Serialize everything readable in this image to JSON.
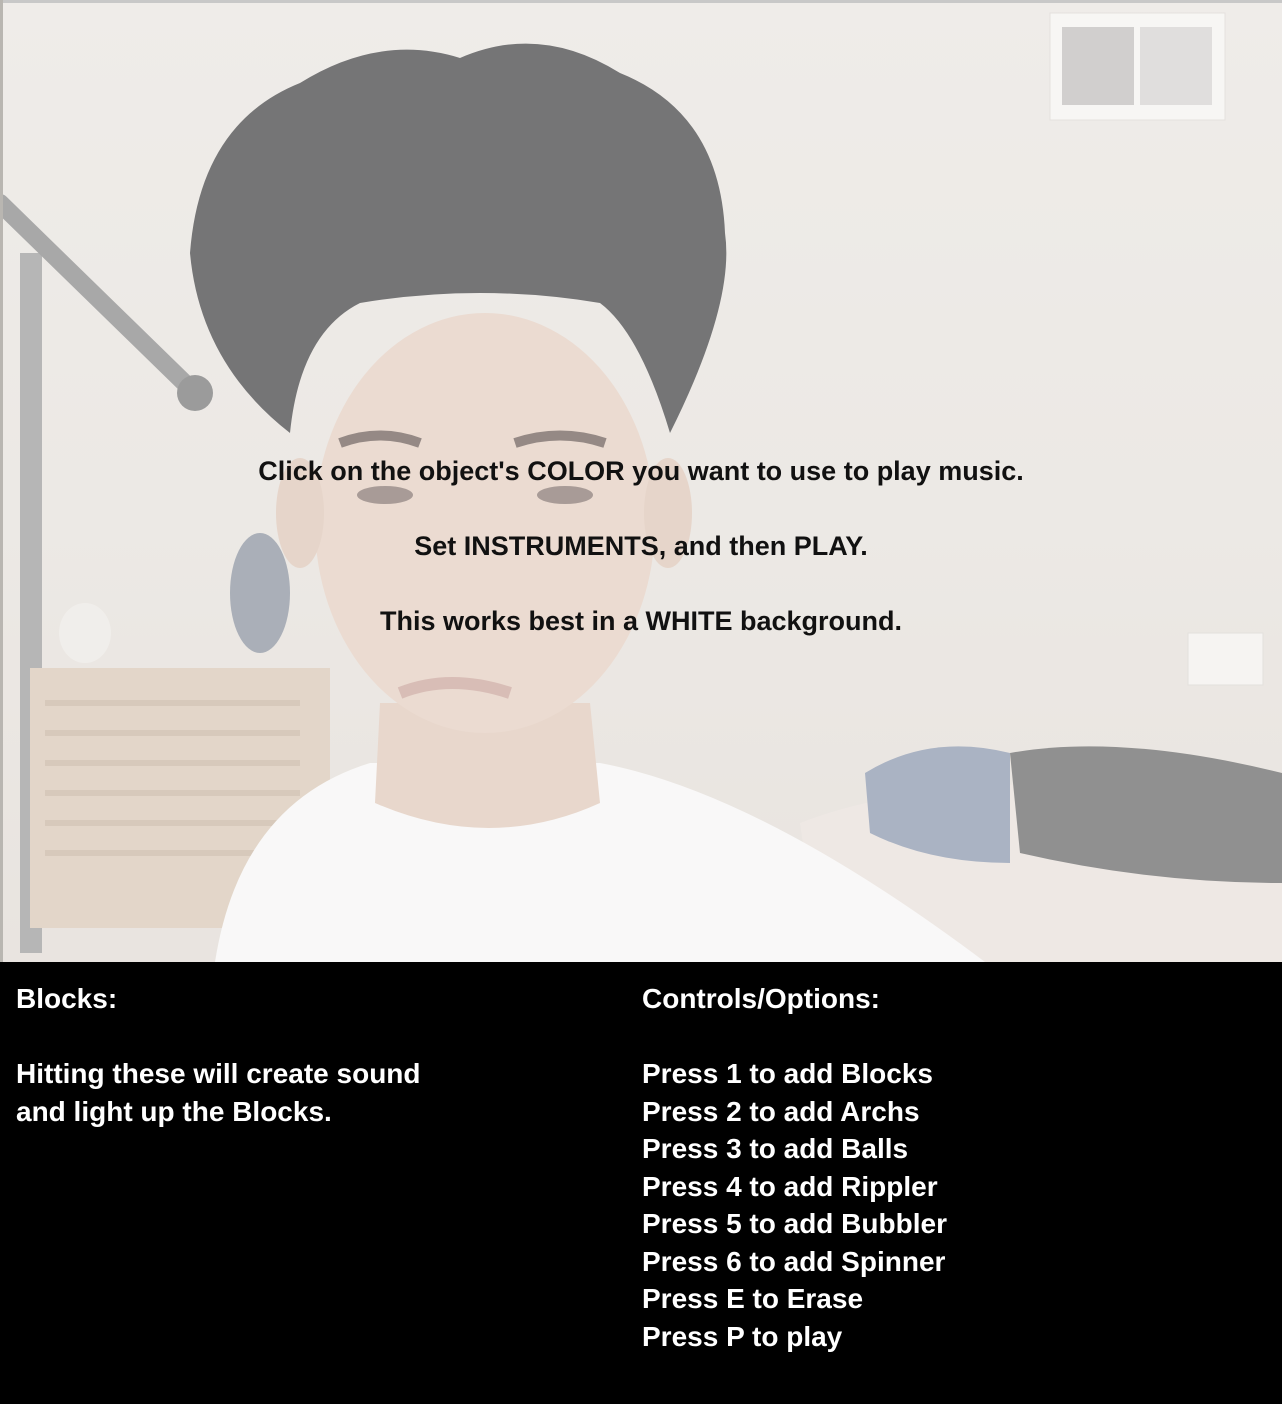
{
  "instructions": {
    "line1": "Click on the object's COLOR you want to use to play music.",
    "line2": "Set INSTRUMENTS, and then PLAY.",
    "line3": "This works best in a WHITE background."
  },
  "blocks_panel": {
    "heading": "Blocks:",
    "description_lines": [
      "Hitting these will create sound",
      "and light up the Blocks."
    ]
  },
  "controls_panel": {
    "heading": "Controls/Options:",
    "items": [
      "Press 1 to add Blocks",
      "Press 2 to add Archs",
      "Press 3 to add Balls",
      "Press 4 to add Rippler",
      "Press 5 to add Bubbler",
      "Press 6 to add Spinner",
      "Press E to Erase",
      "Press P to play"
    ]
  },
  "colors": {
    "panel_background": "#000000",
    "panel_text": "#ffffff",
    "overlay_text": "#111111",
    "wall": "#e4dfd9"
  }
}
